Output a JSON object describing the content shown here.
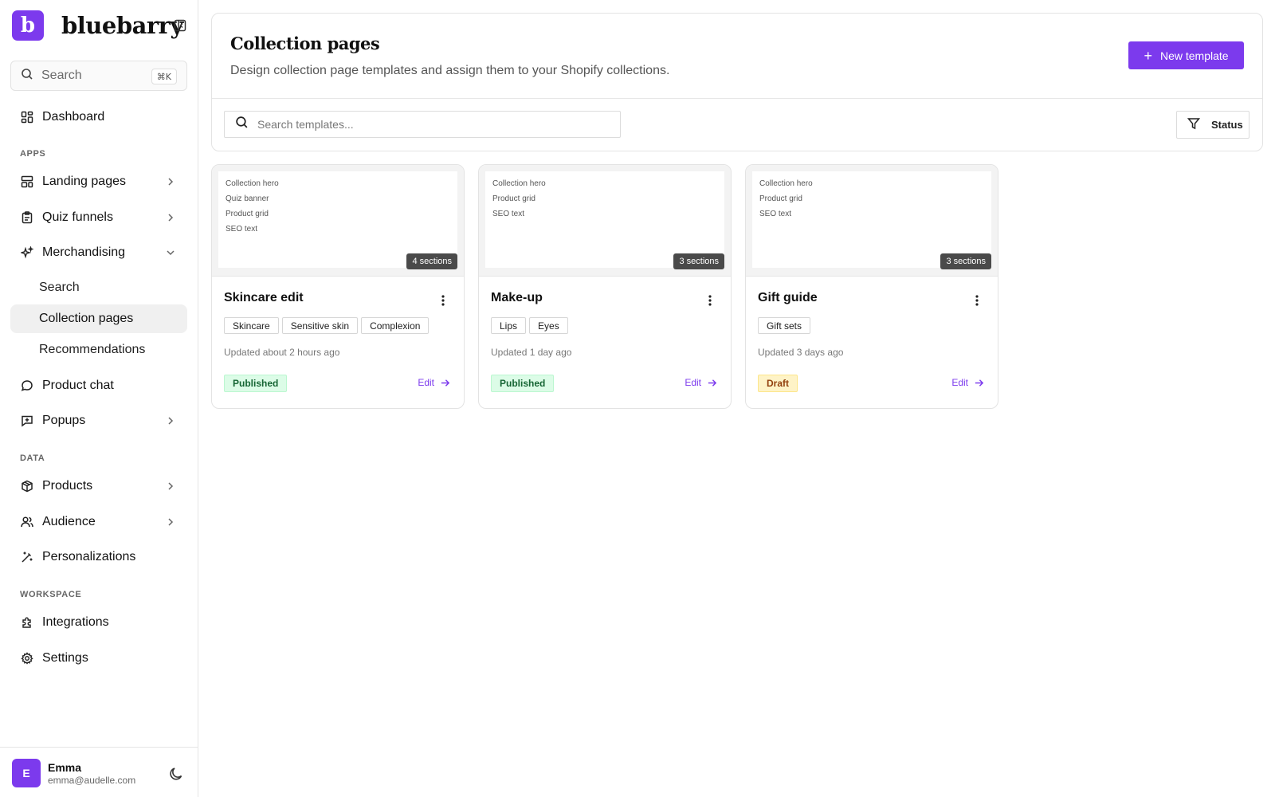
{
  "brand": {
    "logo_letter": "b",
    "name": "bluebarry"
  },
  "sidebar": {
    "search": {
      "placeholder": "Search",
      "shortcut": "⌘K"
    },
    "dashboard": "Dashboard",
    "sections": {
      "apps": "APPS",
      "data": "DATA",
      "workspace": "WORKSPACE"
    },
    "apps": {
      "landing_pages": "Landing pages",
      "quiz_funnels": "Quiz funnels",
      "merchandising": "Merchandising",
      "merch_children": [
        "Search",
        "Collection pages",
        "Recommendations"
      ],
      "product_chat": "Product chat",
      "popups": "Popups"
    },
    "data": {
      "products": "Products",
      "audience": "Audience",
      "personalizations": "Personalizations"
    },
    "workspace": {
      "integrations": "Integrations",
      "settings": "Settings"
    },
    "user": {
      "initial": "E",
      "name": "Emma",
      "email": "emma@audelle.com"
    }
  },
  "header": {
    "title": "Collection pages",
    "subtitle": "Design collection page templates and assign them to your Shopify collections.",
    "new_button": "New template",
    "search_placeholder": "Search templates...",
    "status_filter": "Status"
  },
  "colors": {
    "accent": "#7c3aed",
    "published_bg": "#dcfce7",
    "draft_bg": "#fef3c7"
  },
  "cards": [
    {
      "title": "Skincare edit",
      "preview_lines": [
        "Collection hero",
        "Quiz banner",
        "Product grid",
        "SEO text"
      ],
      "sections": "4 sections",
      "tags": [
        "Skincare",
        "Sensitive skin",
        "Complexion"
      ],
      "updated": "Updated about 2 hours ago",
      "status": "Published",
      "edit": "Edit"
    },
    {
      "title": "Make-up",
      "preview_lines": [
        "Collection hero",
        "Product grid",
        "SEO text"
      ],
      "sections": "3 sections",
      "tags": [
        "Lips",
        "Eyes"
      ],
      "updated": "Updated 1 day ago",
      "status": "Published",
      "edit": "Edit"
    },
    {
      "title": "Gift guide",
      "preview_lines": [
        "Collection hero",
        "Product grid",
        "SEO text"
      ],
      "sections": "3 sections",
      "tags": [
        "Gift sets"
      ],
      "updated": "Updated 3 days ago",
      "status": "Draft",
      "edit": "Edit"
    }
  ]
}
